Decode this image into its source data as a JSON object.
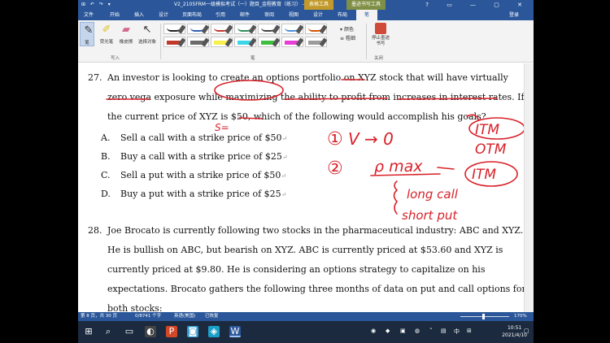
{
  "titlebar": {
    "quick_access": "⊞ ↶ ↷ ▾",
    "title": "V2_2105FRM一级模拟考试（一）题目_金程教育（练习）  -  Word",
    "ctx_table": "表格工具",
    "ctx_ink": "墨迹书写工具",
    "win_buttons": "?  ▭  —  ▢  ✕"
  },
  "tabs": {
    "items": [
      "文件",
      "开始",
      "插入",
      "设计",
      "页面布局",
      "引用",
      "邮件",
      "审阅",
      "视图",
      "设计",
      "布局",
      "笔"
    ],
    "active_index": 11,
    "login": "登录"
  },
  "ribbon": {
    "tools": [
      "笔",
      "荧光笔",
      "橡皮擦",
      "选择对象"
    ],
    "group_write": "写入",
    "group_pens": "笔",
    "color_label": "颜色",
    "thickness_label": "粗细",
    "stop_label": "停止墨迹书写",
    "group_close": "关闭",
    "pen_colors": [
      "#222222",
      "#2f5fb3",
      "#c0392b",
      "#2e8b57",
      "#444444",
      "#4a90d9",
      "#d35400",
      "#c0392b",
      "#6b6b6b",
      "#f7f04a",
      "#3dd6e8",
      "#3fbf3f",
      "#e83dd6",
      "#9b9b9b"
    ]
  },
  "doc": {
    "q27": {
      "number": "27.",
      "lines": [
        "An investor is looking to create an options portfolio on XYZ stock that will have virtually",
        "zero vega exposure while maximizing the ability to profit from increases in interest rates. If",
        "the current price of XYZ is $50, which of the following would accomplish his goals?"
      ],
      "options": [
        {
          "letter": "A.",
          "text": "Sell a call with a strike price of $50"
        },
        {
          "letter": "B.",
          "text": "Buy a call with a strike price of $25"
        },
        {
          "letter": "C.",
          "text": "Sell a put with a strike price of $50"
        },
        {
          "letter": "D.",
          "text": "Buy a put with a strike price of $25"
        }
      ]
    },
    "q28": {
      "number": "28.",
      "lines": [
        "Joe Brocato is currently following two stocks in the pharmaceutical industry: ABC and XYZ.",
        "He is bullish on ABC, but bearish on XYZ. ABC is currently priced at $53.60 and XYZ is",
        "currently priced at $9.80. He is considering an options strategy to capitalize on his",
        "expectations. Brocato gathers the following three months of data on put and call options for",
        "both stocks:"
      ]
    },
    "ink": {
      "s_eq": "S=",
      "circle_one": "①",
      "v_to_0": "V → 0",
      "itm1": "ITM",
      "otm": "OTM",
      "circle_two": "②",
      "rho_max": "ρ max",
      "itm2": "ITM",
      "long_call": "long call",
      "short_put": "short put"
    },
    "ink_color": "#d8222a"
  },
  "status": {
    "page": "第 8 页，共 30 页",
    "words": "0/8741 个字",
    "lang": "英语(美国)",
    "mode": "已恢复",
    "zoom": "170%"
  },
  "taskbar": {
    "time": "10:51",
    "date": "2021/4/10",
    "ime": "中"
  }
}
